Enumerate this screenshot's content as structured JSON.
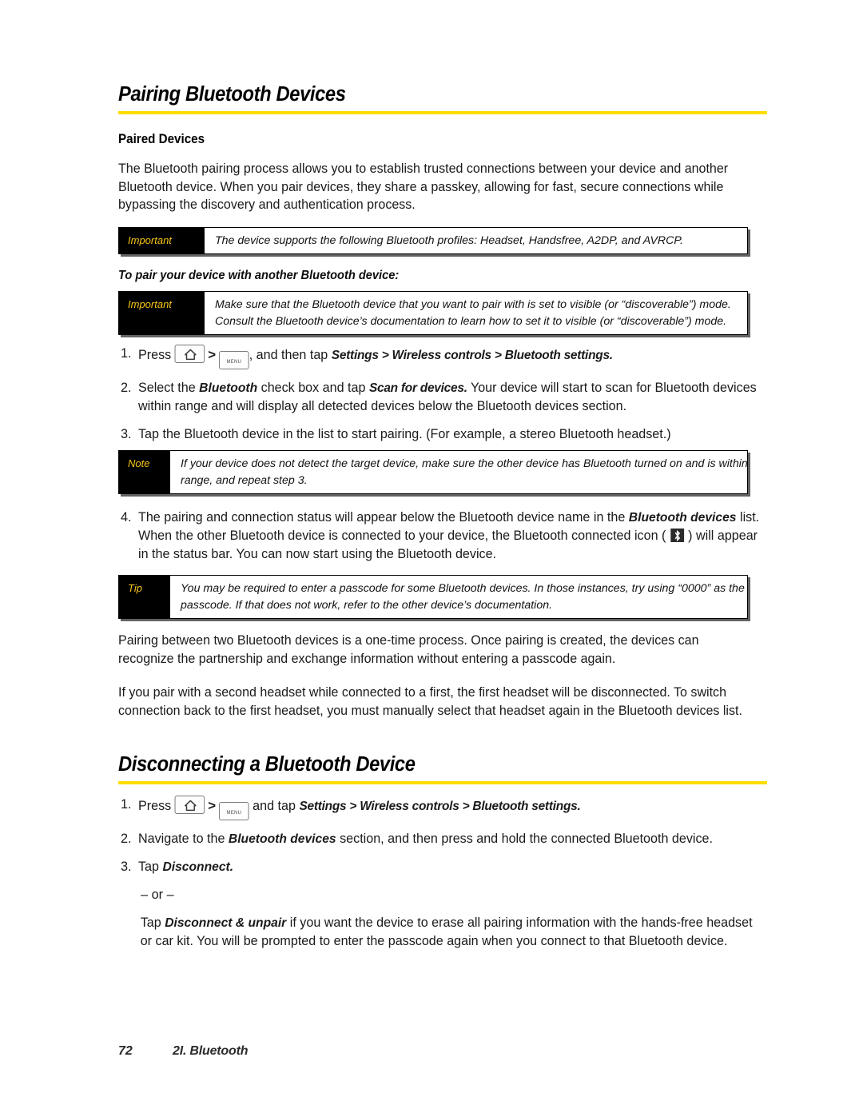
{
  "theme": {
    "rule_color": "#FFDD00",
    "callout_label_bg": "#000000",
    "callout_label_color": "#F5C518",
    "text_color": "#1a1a1a"
  },
  "section1": {
    "heading": "Pairing Bluetooth Devices",
    "subheading": "Paired Devices",
    "intro": "The Bluetooth pairing process allows you to establish trusted connections between your device and another Bluetooth device. When you pair devices, they share a passkey, allowing for fast, secure connections while bypassing the discovery and authentication process.",
    "callout_profiles": {
      "label": "Important",
      "lines": [
        "The device supports the following Bluetooth profiles: Headset, Handsfree, A2DP, and AVRCP."
      ]
    },
    "lead": "To pair your device with another Bluetooth device:",
    "callout_visible": {
      "label": "Important",
      "lines": [
        "Make sure that the Bluetooth device that you want to pair with is set to visible (or “discoverable”) mode.",
        "Consult the Bluetooth device’s documentation to learn how to set it to visible (or “discoverable”) mode."
      ]
    },
    "steps": {
      "step1": {
        "num": "1.",
        "press": "Press",
        "home_key": "home-key",
        "separator": ">",
        "menu_key": "menu",
        "after_keys": ", and then tap",
        "path": "Settings > Wireless controls > Bluetooth settings."
      },
      "step2": {
        "num": "2.",
        "a": "Select the",
        "b": "Bluetooth",
        "c": "check box and tap",
        "d": "Scan for devices.",
        "e": "Your device will start to scan for Bluetooth devices within range and will display all detected devices below the Bluetooth devices section."
      },
      "step3": {
        "num": "3.",
        "text": "Tap the Bluetooth device in the list to start pairing. (For example, a stereo Bluetooth headset.)"
      },
      "step4": {
        "num": "4.",
        "a": "The pairing and connection status will appear below the Bluetooth device name in the",
        "b": "Bluetooth devices",
        "c": "list. When the other Bluetooth device is connected to your device, the Bluetooth connected icon (",
        "icon": "bluetooth-connected-icon",
        "d": ") will appear in the status bar. You can now start using the Bluetooth device."
      }
    },
    "callout_note": {
      "label": "Note",
      "lines": [
        "If your device does not detect the target device, make sure the other device has Bluetooth turned on and is within",
        "range, and repeat step 3."
      ]
    },
    "callout_tip": {
      "label": "Tip",
      "lines": [
        "You may be required to enter a passcode for some Bluetooth devices. In those instances, try using “0000” as the",
        "passcode. If that does not work, refer to the other device’s documentation."
      ]
    },
    "closing1": "Pairing between two Bluetooth devices is a one-time process. Once pairing is created, the devices can recognize the partnership and exchange information without entering a passcode again.",
    "closing2": "If you pair with a second headset while connected to a first, the first headset will be disconnected. To switch connection back to the first headset, you must manually select that headset again in the Bluetooth devices list."
  },
  "section2": {
    "heading": "Disconnecting a Bluetooth Device",
    "steps": {
      "step1": {
        "num": "1.",
        "press": "Press",
        "home_key": "home-key",
        "separator": ">",
        "menu_key": "menu",
        "after_keys": "and tap",
        "path": "Settings > Wireless controls > Bluetooth settings."
      },
      "step2": {
        "num": "2.",
        "a": "Navigate to the",
        "b": "Bluetooth devices",
        "c": "section, and then press and hold the connected Bluetooth device."
      },
      "step3": {
        "num": "3.",
        "a": "Tap",
        "b": "Disconnect."
      }
    },
    "or": "– or –",
    "alt": {
      "a": "Tap",
      "b": "Disconnect & unpair",
      "c": "if you want the device to erase all pairing information with the hands-free headset or car kit. You will be prompted to enter the passcode again when you connect to that Bluetooth device."
    }
  },
  "footer": {
    "page_number": "72",
    "title": "2I. Bluetooth"
  }
}
